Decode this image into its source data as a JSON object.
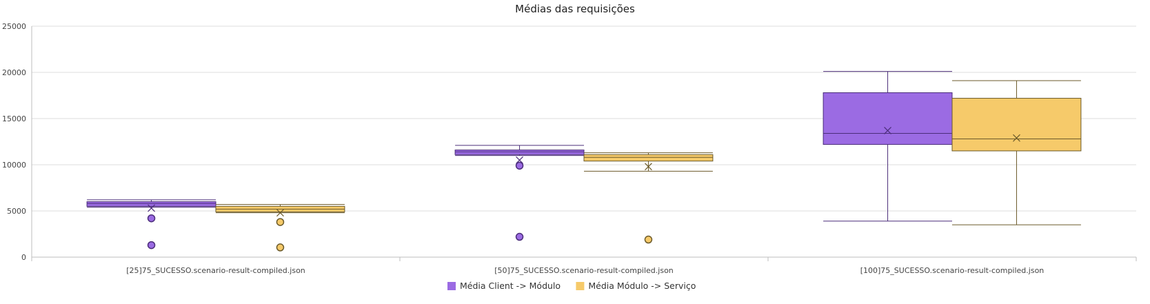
{
  "chart_data": {
    "type": "box",
    "title": "Médias das requisições",
    "xlabel": "",
    "ylabel": "",
    "ylim": [
      0,
      25000
    ],
    "yticks": [
      0,
      5000,
      10000,
      15000,
      20000,
      25000
    ],
    "ytick_labels": [
      "0",
      "5000",
      "10000",
      "15000",
      "20000",
      "25000"
    ],
    "grid": true,
    "legend_position": "bottom",
    "categories": [
      "[25]75_SUCESSO.scenario-result-compiled.json",
      "[50]75_SUCESSO.scenario-result-compiled.json",
      "[100]75_SUCESSO.scenario-result-compiled.json"
    ],
    "series": [
      {
        "name": "Média Client -> Módulo",
        "color": "#9b6be3",
        "stroke": "#4b2d7a",
        "boxes": [
          {
            "min": 5400,
            "q1": 5500,
            "median": 5800,
            "q3": 6000,
            "max": 6200,
            "mean": 5300,
            "outliers": [
              4200,
              1300
            ]
          },
          {
            "min": 11000,
            "q1": 11100,
            "median": 11400,
            "q3": 11600,
            "max": 12100,
            "mean": 10500,
            "outliers": [
              9900,
              2200
            ]
          },
          {
            "min": 3900,
            "q1": 12200,
            "median": 13400,
            "q3": 17800,
            "max": 20100,
            "mean": 13700,
            "outliers": []
          }
        ]
      },
      {
        "name": "Média Módulo -> Serviço",
        "color": "#f6ca6a",
        "stroke": "#6b5a2a",
        "boxes": [
          {
            "min": 4800,
            "q1": 4900,
            "median": 5200,
            "q3": 5500,
            "max": 5700,
            "mean": 4800,
            "outliers": [
              3800,
              1050
            ]
          },
          {
            "min": 9300,
            "q1": 10400,
            "median": 10800,
            "q3": 11100,
            "max": 11300,
            "mean": 9800,
            "outliers": [
              1900
            ]
          },
          {
            "min": 3500,
            "q1": 11500,
            "median": 12800,
            "q3": 17200,
            "max": 19100,
            "mean": 12900,
            "outliers": []
          }
        ]
      }
    ]
  }
}
